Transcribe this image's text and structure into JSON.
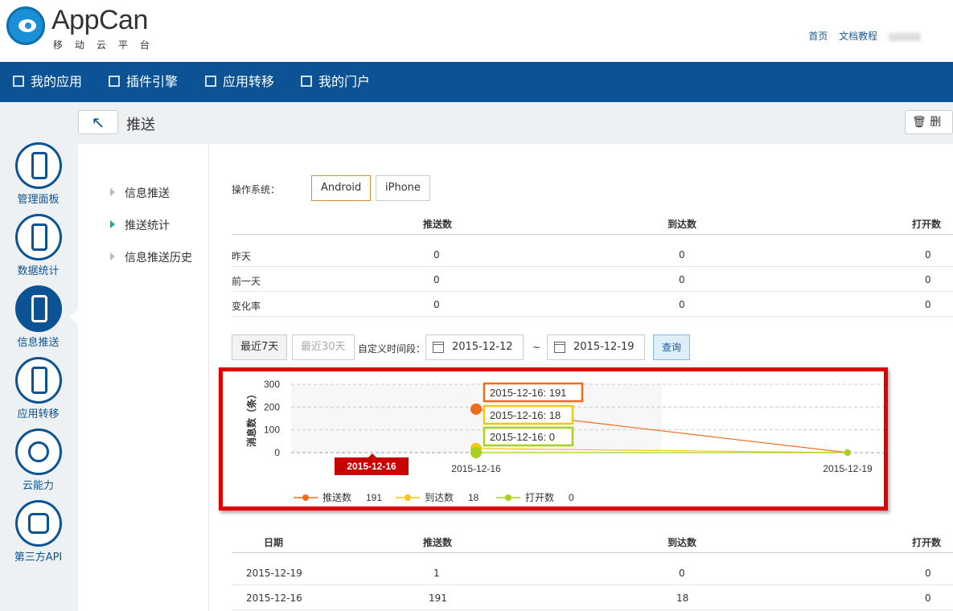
{
  "header": {
    "logo_text": "AppCan",
    "logo_sub": "移动云平台",
    "links": [
      "首页",
      "文档教程"
    ]
  },
  "nav": {
    "items": [
      {
        "label": "我的应用",
        "icon": "app-icon"
      },
      {
        "label": "插件引擎",
        "icon": "plugin-icon"
      },
      {
        "label": "应用转移",
        "icon": "transfer-icon"
      },
      {
        "label": "我的门户",
        "icon": "portal-icon"
      }
    ]
  },
  "sidebar": {
    "items": [
      {
        "label": "管理面板",
        "icon": "dashboard-icon"
      },
      {
        "label": "数据统计",
        "icon": "statistics-icon"
      },
      {
        "label": "信息推送",
        "icon": "push-icon",
        "active": true
      },
      {
        "label": "应用转移",
        "icon": "transfer-icon"
      },
      {
        "label": "云能力",
        "icon": "cloud-gear-icon"
      },
      {
        "label": "第三方API",
        "icon": "puzzle-icon"
      }
    ]
  },
  "titlebar": {
    "back_symbol": "↖",
    "title": "推送",
    "delete_label": "删"
  },
  "submenu": {
    "items": [
      "信息推送",
      "推送统计",
      "信息推送历史"
    ],
    "active_index": 1
  },
  "os": {
    "label": "操作系统：",
    "options": [
      "Android",
      "iPhone"
    ],
    "selected": "Android"
  },
  "summary": {
    "headers": [
      "",
      "推送数",
      "到达数",
      "打开数"
    ],
    "rows": [
      [
        "昨天",
        "0",
        "0",
        "0"
      ],
      [
        "前一天",
        "0",
        "0",
        "0"
      ],
      [
        "变化率",
        "0",
        "0",
        "0"
      ]
    ]
  },
  "range": {
    "btn_7": "最近7天",
    "btn_30": "最近30天",
    "custom_label": "自定义时间段：",
    "start": "2015-12-12",
    "tilde": "~",
    "end": "2015-12-19",
    "query": "查询"
  },
  "chart_data": {
    "type": "line",
    "x": [
      "2015-12-16",
      "2015-12-19"
    ],
    "ylabel": "消息数（条）",
    "ylim": [
      0,
      300
    ],
    "yticks": [
      0,
      100,
      200,
      300
    ],
    "series": [
      {
        "name": "推送数",
        "values": [
          191,
          0
        ],
        "color": "#f26b1d",
        "total": "191"
      },
      {
        "name": "到达数",
        "values": [
          18,
          0
        ],
        "color": "#f2c811",
        "total": "18"
      },
      {
        "name": "打开数",
        "values": [
          0,
          0
        ],
        "color": "#a6d21f",
        "total": "0"
      }
    ],
    "tooltips": [
      "2015-12-16: 191",
      "2015-12-16: 18",
      "2015-12-16: 0"
    ],
    "hover_label": "2015-12-16",
    "legend_position": "bottom"
  },
  "detail": {
    "headers": [
      "日期",
      "推送数",
      "到达数",
      "打开数"
    ],
    "rows": [
      [
        "2015-12-19",
        "1",
        "0",
        "0"
      ],
      [
        "2015-12-16",
        "191",
        "18",
        "0"
      ]
    ]
  },
  "colors": {
    "nav_bg": "#0b5394",
    "highlight_border": "#e00000"
  }
}
